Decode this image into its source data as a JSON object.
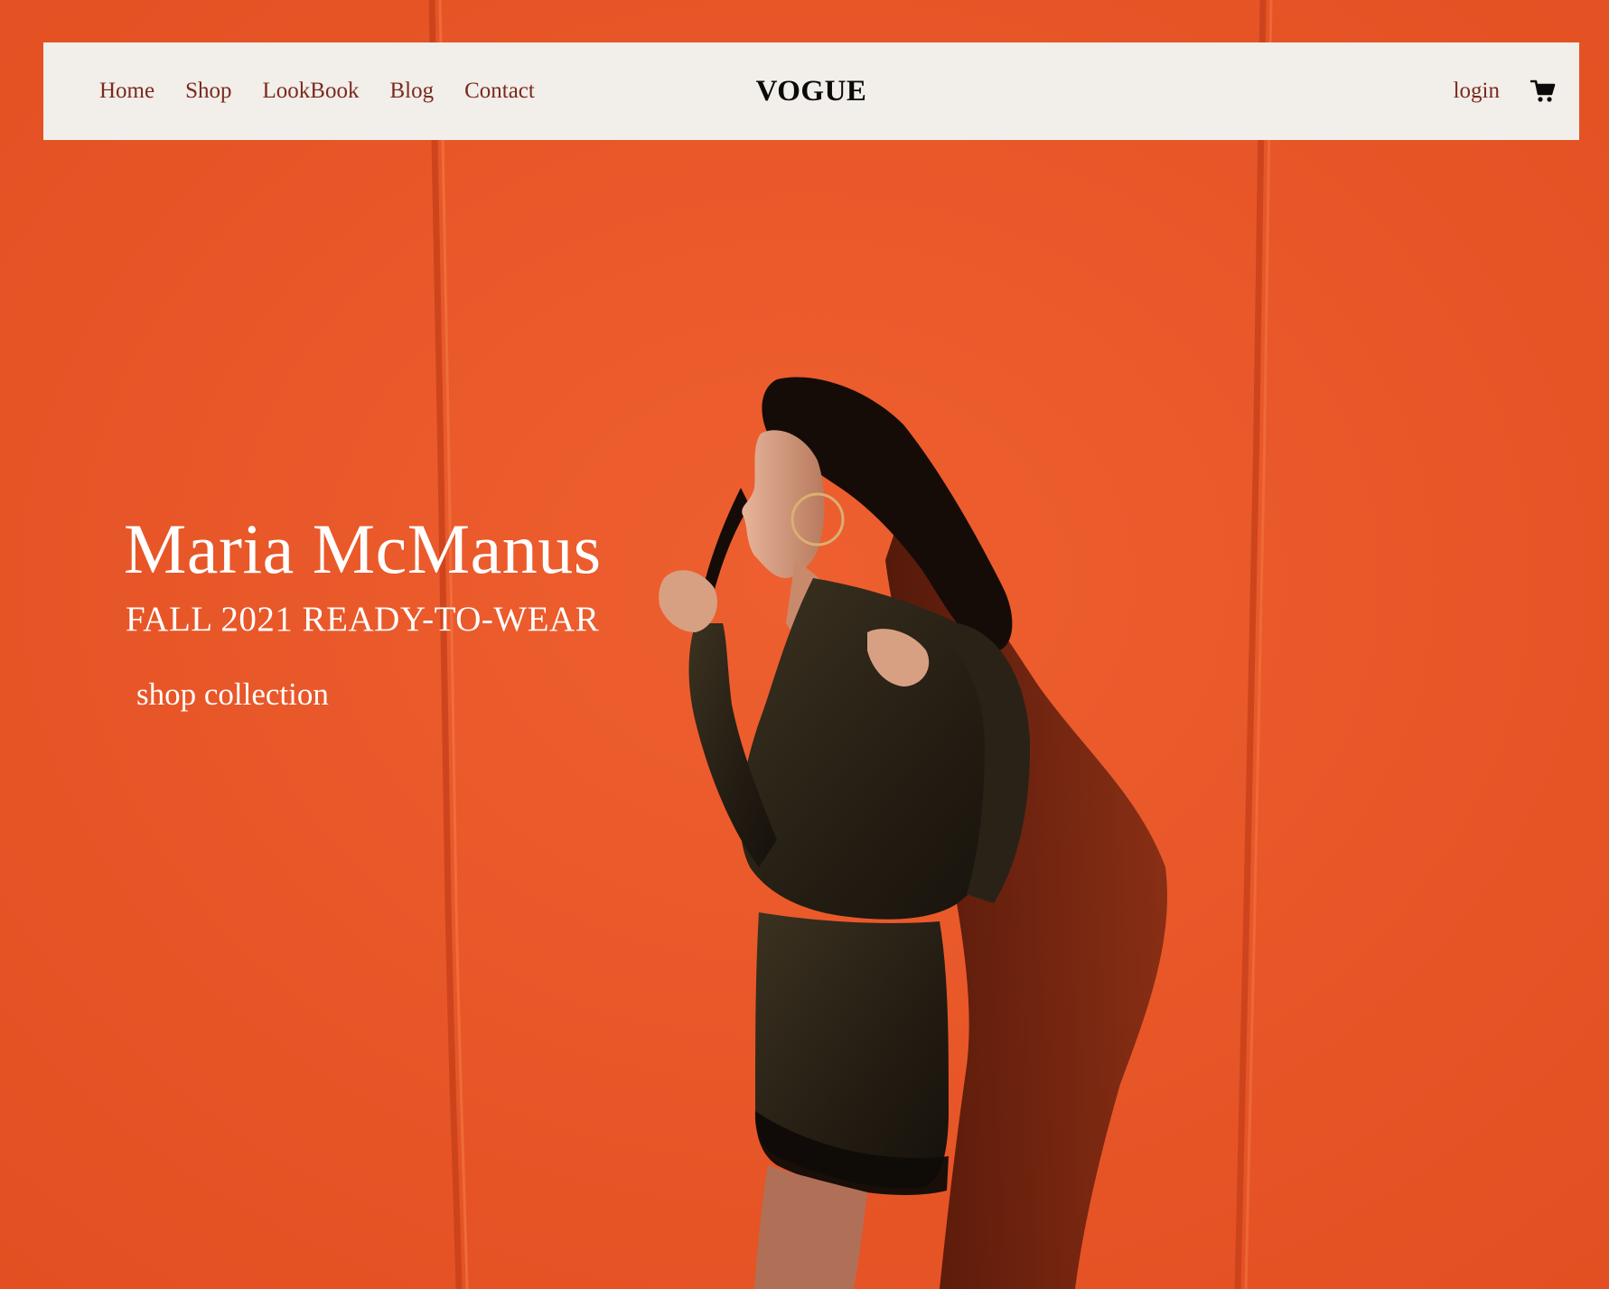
{
  "colors": {
    "wall": "#e9562a",
    "navbar_bg": "#f2eee9",
    "nav_link": "#7a2a1f",
    "brand": "#0a0a0a",
    "hero_text": "#ffffff"
  },
  "navbar": {
    "links": [
      "Home",
      "Shop",
      "LookBook",
      "Blog",
      "Contact"
    ],
    "brand": "VOGUE",
    "login_label": "login",
    "cart_icon": "shopping-cart-icon"
  },
  "hero": {
    "designer_name": "Maria McManus",
    "collection_title": "FALL 2021 READY-TO-WEAR",
    "cta_label": "shop collection"
  }
}
